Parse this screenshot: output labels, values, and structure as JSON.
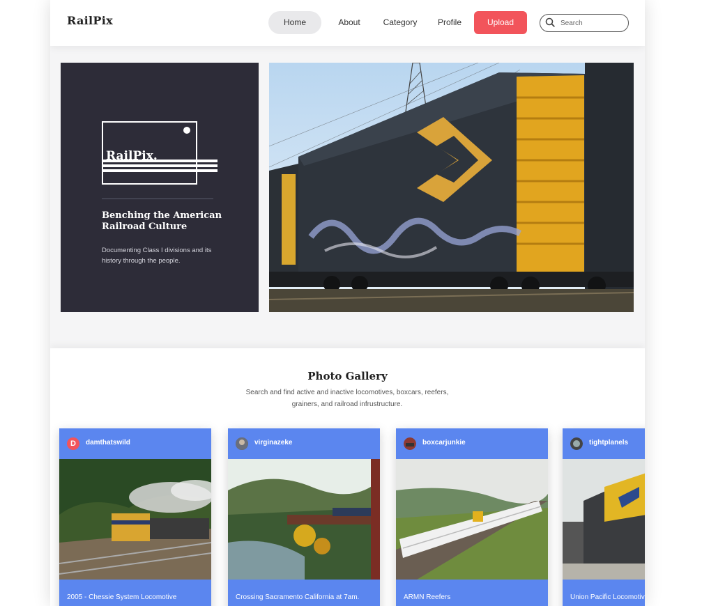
{
  "header": {
    "logo": "RailPix",
    "nav": {
      "home": "Home",
      "about": "About",
      "category": "Category",
      "profile": "Profile"
    },
    "upload_label": "Upload",
    "search_placeholder": "Search"
  },
  "hero": {
    "logo_text": "RailPix.",
    "title": "Benching the American Railroad Culture",
    "subtitle": "Documenting Class I divisions and its history through the people."
  },
  "gallery": {
    "title": "Photo Gallery",
    "subtitle": "Search and find active and inactive locomotives, boxcars, reefers, grainers, and railroad infrustructure.",
    "cards": [
      {
        "avatar": "D",
        "username": "damthatswild",
        "caption": "2005 - Chessie System Locomotive"
      },
      {
        "avatar": "",
        "username": "virginazeke",
        "caption": "Crossing Sacramento California at 7am."
      },
      {
        "avatar": "",
        "username": "boxcarjunkie",
        "caption": "ARMN Reefers"
      },
      {
        "avatar": "",
        "username": "tightplanels",
        "caption": "Union Pacific Locomotive"
      }
    ]
  },
  "colors": {
    "accent": "#f2545b",
    "card_blue": "#5b86ef",
    "hero_dark": "#2d2c38"
  }
}
